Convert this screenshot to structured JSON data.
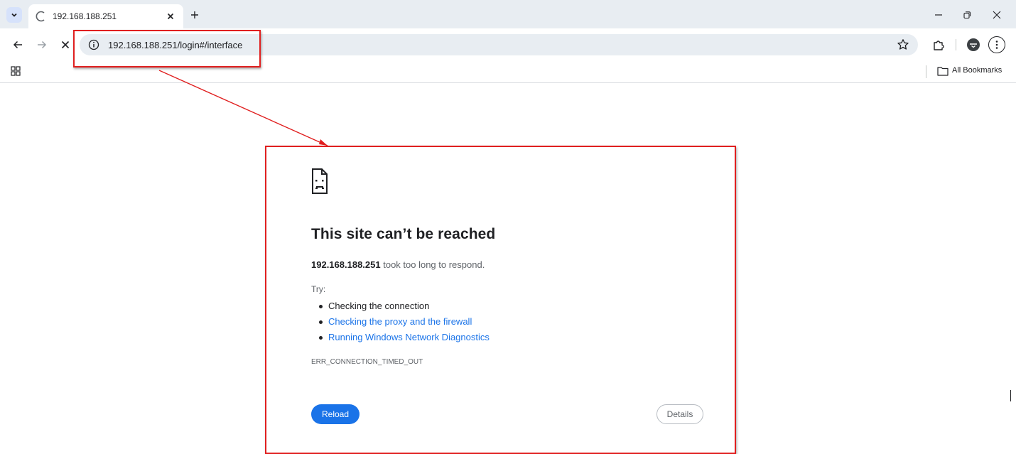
{
  "tab": {
    "title": "192.168.188.251",
    "loading_icon": "loading-spinner-icon",
    "close_icon": "close-icon"
  },
  "toolbar": {
    "url": "192.168.188.251/login#/interface"
  },
  "bookmarks": {
    "all_bookmarks_label": "All Bookmarks"
  },
  "error_page": {
    "title": "This site can’t be reached",
    "host": "192.168.188.251",
    "message": " took too long to respond.",
    "try_label": "Try:",
    "suggestions": [
      "Checking the connection",
      "Checking the proxy and the firewall",
      "Running Windows Network Diagnostics"
    ],
    "error_code": "ERR_CONNECTION_TIMED_OUT",
    "reload_label": "Reload",
    "details_label": "Details"
  },
  "colors": {
    "annotation": "#e01f1f",
    "link": "#1a73e8",
    "primary_button": "#1a73e8",
    "chrome_bg": "#e8edf2"
  }
}
